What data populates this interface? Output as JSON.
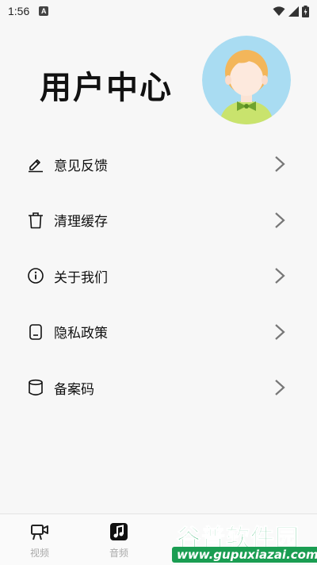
{
  "status_bar": {
    "time": "1:56",
    "notification_letter": "A"
  },
  "header": {
    "title": "用户中心"
  },
  "menu": {
    "items": [
      {
        "label": "意见反馈",
        "icon": "edit-icon"
      },
      {
        "label": "清理缓存",
        "icon": "trash-icon"
      },
      {
        "label": "关于我们",
        "icon": "info-icon"
      },
      {
        "label": "隐私政策",
        "icon": "document-icon"
      },
      {
        "label": "备案码",
        "icon": "database-icon"
      }
    ]
  },
  "bottom_nav": {
    "items": [
      {
        "label": "视频",
        "icon": "video-camera-icon"
      },
      {
        "label": "音频",
        "icon": "music-note-icon"
      }
    ]
  },
  "watermark": {
    "title": "谷普软件园",
    "url": "www.gupuxiazai.com"
  },
  "colors": {
    "avatar_bg": "#a9dcf2",
    "watermark_green": "#17a85a"
  }
}
